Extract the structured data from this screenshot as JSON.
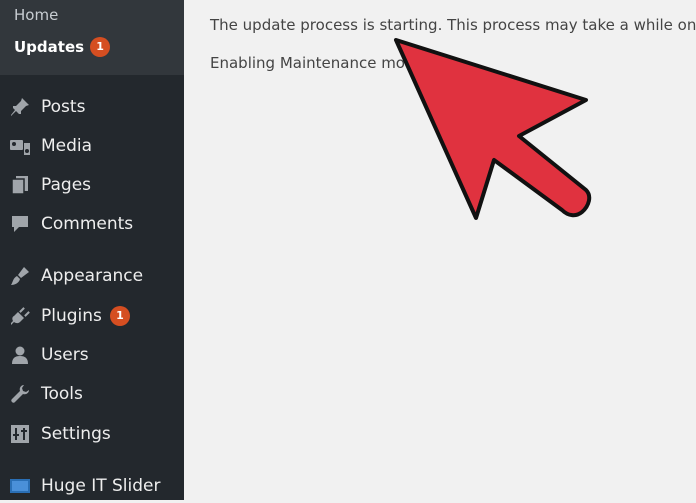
{
  "sidebar": {
    "submenu": {
      "home_label": "Home",
      "updates_label": "Updates",
      "updates_badge": "1"
    },
    "items": [
      {
        "label": "Posts",
        "icon": "pin-icon"
      },
      {
        "label": "Media",
        "icon": "media-icon"
      },
      {
        "label": "Pages",
        "icon": "pages-icon"
      },
      {
        "label": "Comments",
        "icon": "comment-icon"
      },
      {
        "label": "Appearance",
        "icon": "paintbrush-icon"
      },
      {
        "label": "Plugins",
        "icon": "plug-icon",
        "badge": "1"
      },
      {
        "label": "Users",
        "icon": "user-icon"
      },
      {
        "label": "Tools",
        "icon": "wrench-icon"
      },
      {
        "label": "Settings",
        "icon": "sliders-icon"
      },
      {
        "label": "Huge IT Slider",
        "icon": "slider-icon"
      }
    ]
  },
  "main": {
    "status_line": "The update process is starting. This process may take a while on some",
    "maintenance_line": "Enabling Maintenance mode..."
  },
  "colors": {
    "sidebar_bg": "#23282d",
    "submenu_bg": "#32373c",
    "badge": "#d54e21",
    "arrow": "#e0323f"
  }
}
